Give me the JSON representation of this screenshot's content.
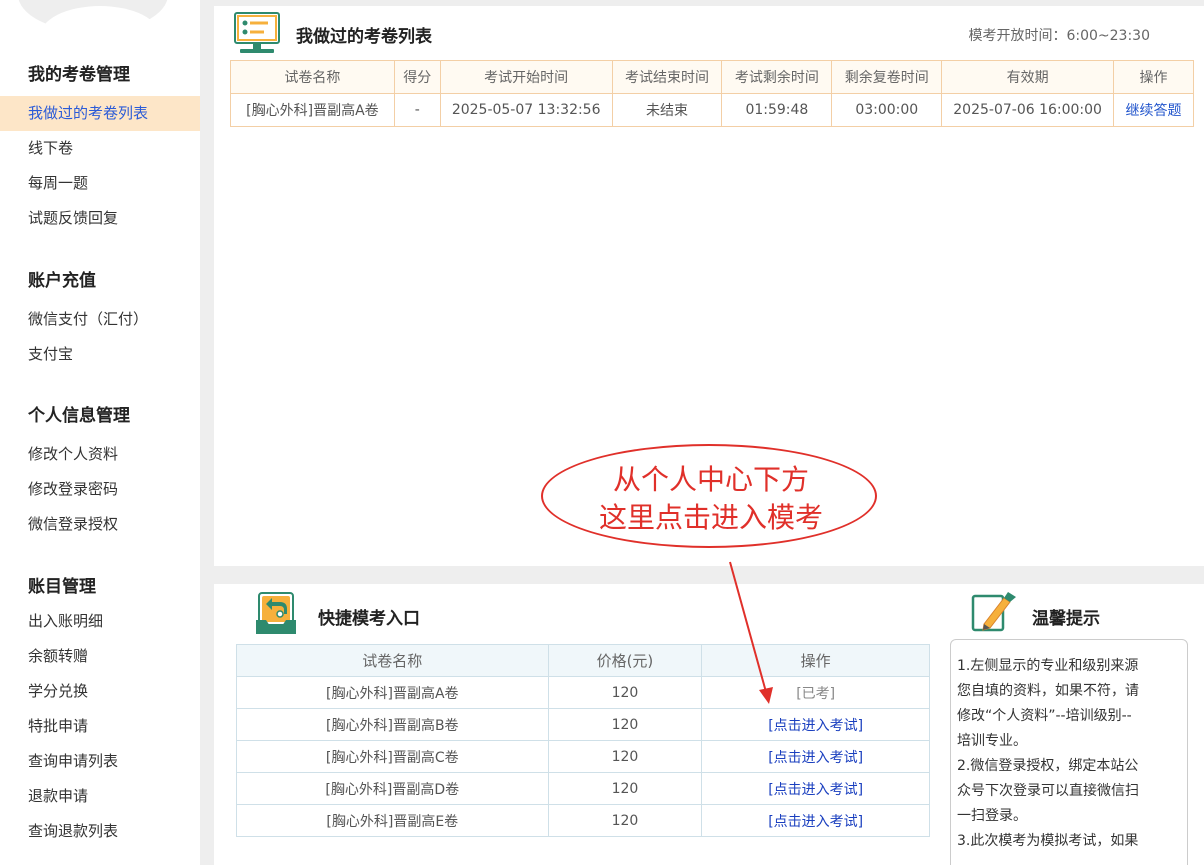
{
  "sidebar": {
    "sections": [
      {
        "title": "我的考卷管理",
        "items": [
          {
            "label": "我做过的考卷列表",
            "active": true
          },
          {
            "label": "线下卷"
          },
          {
            "label": "每周一题"
          },
          {
            "label": "试题反馈回复"
          }
        ]
      },
      {
        "title": "账户充值",
        "items": [
          {
            "label": "微信支付（汇付）"
          },
          {
            "label": "支付宝"
          }
        ]
      },
      {
        "title": "个人信息管理",
        "items": [
          {
            "label": "修改个人资料"
          },
          {
            "label": "修改登录密码"
          },
          {
            "label": "微信登录授权"
          }
        ]
      },
      {
        "title": "账目管理",
        "items": [
          {
            "label": "出入账明细"
          },
          {
            "label": "余额转赠"
          },
          {
            "label": "学分兑换"
          },
          {
            "label": "特批申请"
          },
          {
            "label": "查询申请列表"
          },
          {
            "label": "退款申请"
          },
          {
            "label": "查询退款列表"
          }
        ]
      }
    ]
  },
  "exam_list": {
    "title": "我做过的考卷列表",
    "open_time": "模考开放时间：6:00~23:30",
    "headers": [
      "试卷名称",
      "得分",
      "考试开始时间",
      "考试结束时间",
      "考试剩余时间",
      "剩余复卷时间",
      "有效期",
      "操作"
    ],
    "rows": [
      [
        "[胸心外科]晋副高A卷",
        "-",
        "2025-05-07 13:32:56",
        "未结束",
        "01:59:48",
        "03:00:00",
        "2025-07-06 16:00:00",
        "继续答题"
      ]
    ]
  },
  "quick": {
    "title": "快捷模考入口",
    "headers": [
      "试卷名称",
      "价格(元)",
      "操作"
    ],
    "rows": [
      {
        "name": "[胸心外科]晋副高A卷",
        "price": "120",
        "action": "[已考]",
        "done": true
      },
      {
        "name": "[胸心外科]晋副高B卷",
        "price": "120",
        "action": "[点击进入考试]",
        "done": false
      },
      {
        "name": "[胸心外科]晋副高C卷",
        "price": "120",
        "action": "[点击进入考试]",
        "done": false
      },
      {
        "name": "[胸心外科]晋副高D卷",
        "price": "120",
        "action": "[点击进入考试]",
        "done": false
      },
      {
        "name": "[胸心外科]晋副高E卷",
        "price": "120",
        "action": "[点击进入考试]",
        "done": false
      }
    ]
  },
  "tips": {
    "title": "温馨提示",
    "lines": [
      "1.左侧显示的专业和级别来源",
      "您自填的资料，如果不符，请",
      "修改“个人资料”--培训级别--",
      "培训专业。",
      "2.微信登录授权，绑定本站公",
      "众号下次登录可以直接微信扫",
      "一扫登录。",
      "3.此次模考为模拟考试，如果"
    ]
  },
  "annotation": {
    "line1": "从个人中心下方",
    "line2": "这里点击进入模考",
    "color": "#e0302a"
  }
}
